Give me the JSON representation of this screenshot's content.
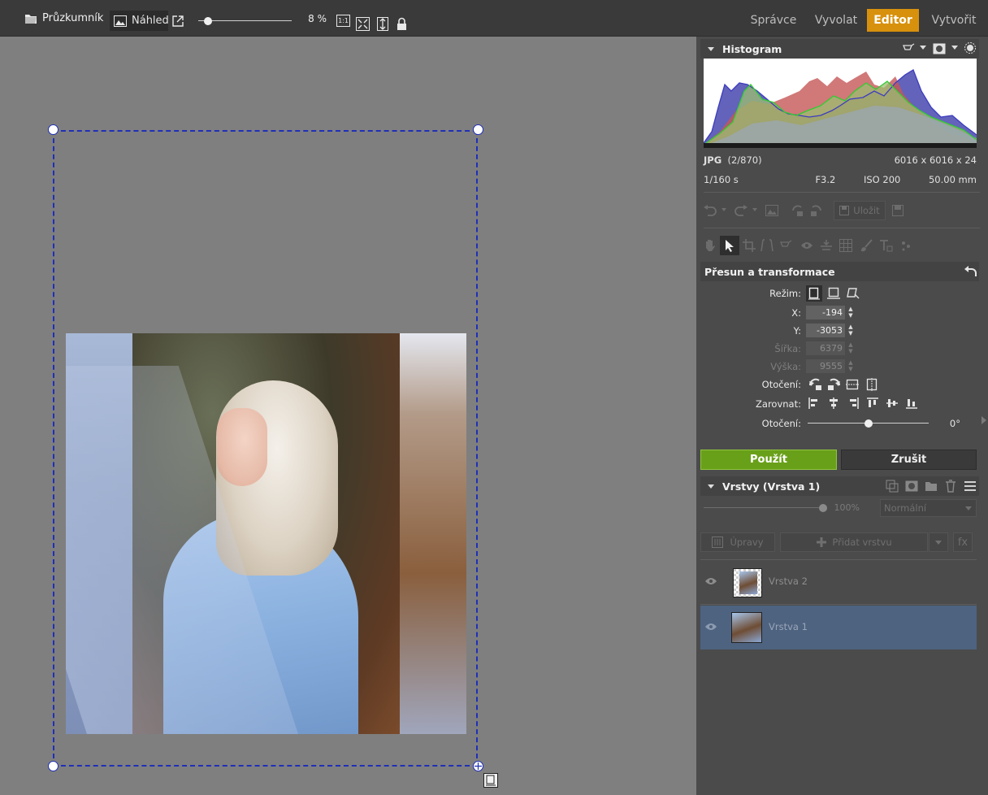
{
  "topbar": {
    "browser_label": "Průzkumník",
    "preview_label": "Náhled",
    "zoom_value": 0.07,
    "zoom_text": "8 %",
    "one_to_one": "1:1",
    "modes": [
      "Správce",
      "Vyvolat",
      "Editor",
      "Vytvořit"
    ],
    "active_mode": "Editor"
  },
  "histogram": {
    "title": "Histogram",
    "format": "JPG",
    "index": "(2/870)",
    "dimensions": "6016 x 6016 x 24",
    "shutter": "1/160 s",
    "aperture": "F3.2",
    "iso": "ISO 200",
    "focal": "50.00 mm"
  },
  "toolbar": {
    "save_label": "Uložit"
  },
  "transform": {
    "title": "Přesun a transformace",
    "mode_label": "Režim:",
    "x_label": "X:",
    "x_value": "-194",
    "y_label": "Y:",
    "y_value": "-3053",
    "width_label": "Šířka:",
    "width_value": "6379",
    "height_label": "Výška:",
    "height_value": "9555",
    "rotate_label": "Otočení:",
    "align_label": "Zarovnat:",
    "rotation_label": "Otočení:",
    "rotation_value": "0°",
    "rotation_fraction": 0.5,
    "apply_label": "Použít",
    "cancel_label": "Zrušit"
  },
  "layers": {
    "title": "Vrstvy (Vrstva 1)",
    "opacity_text": "100%",
    "opacity_fraction": 1.0,
    "blend_mode": "Normální",
    "adjust_label": "Úpravy",
    "add_layer_label": "Přidat vrstvu",
    "fx_label": "fx",
    "items": [
      {
        "name": "Vrstva 2",
        "selected": false
      },
      {
        "name": "Vrstva 1",
        "selected": true
      }
    ]
  }
}
